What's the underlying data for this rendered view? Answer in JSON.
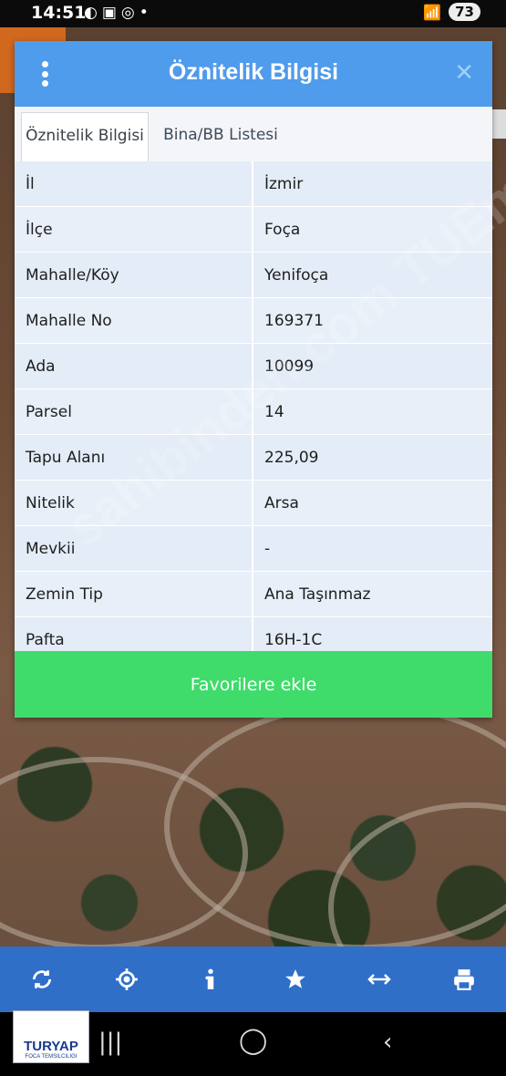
{
  "status_bar": {
    "time": "14:51",
    "battery": "73"
  },
  "dialog": {
    "title": "Öznitelik Bilgisi",
    "tabs": [
      {
        "label": "Öznitelik Bilgisi",
        "active": true
      },
      {
        "label": "Bina/BB Listesi",
        "active": false
      }
    ],
    "rows": [
      {
        "key": "İl",
        "value": "İzmir"
      },
      {
        "key": "İlçe",
        "value": "Foça"
      },
      {
        "key": "Mahalle/Köy",
        "value": "Yenifoça"
      },
      {
        "key": "Mahalle No",
        "value": "169371"
      },
      {
        "key": "Ada",
        "value": "10099"
      },
      {
        "key": "Parsel",
        "value": "14"
      },
      {
        "key": "Tapu Alanı",
        "value": "225,09"
      },
      {
        "key": "Nitelik",
        "value": "Arsa"
      },
      {
        "key": "Mevkii",
        "value": "-"
      },
      {
        "key": "Zemin Tip",
        "value": "Ana Taşınmaz"
      },
      {
        "key": "Pafta",
        "value": "16H-1C"
      }
    ],
    "favorite_button": "Favorilere ekle"
  },
  "watermark": "sahibinden.com TUEmlakjet.com",
  "logo": {
    "brand": "TURYAP",
    "sub": "FOCA TEMSILCILIGI"
  },
  "toolbar_icons": [
    "refresh-icon",
    "locate-icon",
    "info-icon",
    "star-icon",
    "measure-icon",
    "print-icon"
  ],
  "colors": {
    "header": "#4f9bec",
    "favorite": "#3fdb6b",
    "toolbar": "#2f6fc8"
  }
}
